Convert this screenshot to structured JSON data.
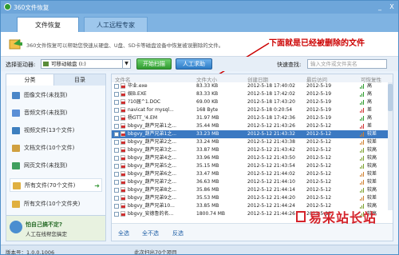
{
  "window": {
    "title": "360文件恢复",
    "minimize": "_",
    "close": "X"
  },
  "tabs": [
    {
      "label": "文件恢复"
    },
    {
      "label": "人工远程专家"
    }
  ],
  "info": {
    "description": "360文件恢复可以帮助您快速从硬盘、U盘、SD卡等磁盘设备中恢复被误删除的文件。",
    "annotation": "下面就是已经被删除的文件"
  },
  "toolbar": {
    "drive_label": "选择驱动器:",
    "drive_value": "可移动磁盘 (I:)",
    "scan_button": "开始扫描",
    "help_button": "人工求助",
    "quick_search_label": "快速查找:",
    "search_placeholder": "输入文件或文件夹名"
  },
  "sidebar": {
    "tabs": [
      {
        "label": "分类"
      },
      {
        "label": "目录"
      }
    ],
    "items": [
      {
        "label": "图像文件(未找到)",
        "color": "#4a86c8"
      },
      {
        "label": "音频文件(未找到)",
        "color": "#5b8fd6"
      },
      {
        "label": "视频文件(13个文件)",
        "color": "#3d7fbf"
      },
      {
        "label": "文档文件(10个文件)",
        "color": "#d0a040"
      },
      {
        "label": "网页文件(未找到)",
        "color": "#3f9f5f"
      },
      {
        "label": "所有文件(70个文件)",
        "color": "#e0b040"
      },
      {
        "label": "所有文件(10个文件夹)",
        "color": "#e0b040"
      }
    ],
    "help_title": "怕自己搞不定?",
    "help_sub": "人工在线帮您搞定"
  },
  "table": {
    "headers": [
      "文件名",
      "文件大小",
      "创建日期",
      "最后访问",
      "可恢复性"
    ],
    "rows": [
      {
        "name": "毕业.exe",
        "size": "83.33 KB",
        "created": "2012-5-18 17:40:02",
        "accessed": "2012-5-19",
        "recov": "高",
        "color": "#2a9a2a"
      },
      {
        "name": "娱B.EXE",
        "size": "83.33 KB",
        "created": "2012-5-18 17:42:02",
        "accessed": "2012-5-19",
        "recov": "高",
        "color": "#2a9a2a"
      },
      {
        "name": "?10届^1.DOC",
        "size": "69.00 KB",
        "created": "2012-5-18 17:43:20",
        "accessed": "2012-5-19",
        "recov": "高",
        "color": "#2a9a2a"
      },
      {
        "name": "navicat for mysql...",
        "size": "168 Byte",
        "created": "2012-5-18 0:20:54",
        "accessed": "2012-5-19",
        "recov": "差",
        "color": "#d03030"
      },
      {
        "name": "杨GTT_'4.EM",
        "size": "31.97 MB",
        "created": "2012-5-18 17:42:36",
        "accessed": "2012-5-19",
        "recov": "高",
        "color": "#2a9a2a"
      },
      {
        "name": "bbgvy_葫芦兄弟1之...",
        "size": "35.44 MB",
        "created": "2012-5-12 21:43:26",
        "accessed": "2012-5-12",
        "recov": "差",
        "color": "#d03030"
      },
      {
        "name": "bbgvy_葫芦兄弟1之...",
        "size": "33.23 MB",
        "created": "2012-5-12 21:43:32",
        "accessed": "2012-5-12",
        "recov": "较差",
        "color": "#d08030",
        "selected": true
      },
      {
        "name": "bbgvy_葫芦兄弟2之...",
        "size": "33.24 MB",
        "created": "2012-5-12 21:43:38",
        "accessed": "2012-5-12",
        "recov": "较差",
        "color": "#d08030"
      },
      {
        "name": "bbgvy_葫芦兄弟3之...",
        "size": "33.87 MB",
        "created": "2012-5-12 21:43:42",
        "accessed": "2012-5-12",
        "recov": "较高",
        "color": "#7aa02a"
      },
      {
        "name": "bbgvy_葫芦兄弟4之...",
        "size": "33.96 MB",
        "created": "2012-5-12 21:43:50",
        "accessed": "2012-5-12",
        "recov": "较高",
        "color": "#7aa02a"
      },
      {
        "name": "bbgvy_葫芦兄弟5之...",
        "size": "35.15 MB",
        "created": "2012-5-12 21:43:54",
        "accessed": "2012-5-12",
        "recov": "较高",
        "color": "#7aa02a"
      },
      {
        "name": "bbgvy_葫芦兄弟6之...",
        "size": "33.47 MB",
        "created": "2012-5-12 21:44:02",
        "accessed": "2012-5-12",
        "recov": "较差",
        "color": "#d08030"
      },
      {
        "name": "bbgvy_葫芦兄弟7之...",
        "size": "36.63 MB",
        "created": "2012-5-12 21:44:10",
        "accessed": "2012-5-12",
        "recov": "较差",
        "color": "#d08030"
      },
      {
        "name": "bbgvy_葫芦兄弟8之...",
        "size": "35.86 MB",
        "created": "2012-5-12 21:44:14",
        "accessed": "2012-5-12",
        "recov": "较高",
        "color": "#7aa02a"
      },
      {
        "name": "bbgvy_葫芦兄弟9之...",
        "size": "35.53 MB",
        "created": "2012-5-12 21:44:20",
        "accessed": "2012-5-12",
        "recov": "较差",
        "color": "#d08030"
      },
      {
        "name": "bbgvy_葫芦兄弟10...",
        "size": "33.85 MB",
        "created": "2012-5-12 21:44:24",
        "accessed": "2012-5-12",
        "recov": "较高",
        "color": "#7aa02a"
      },
      {
        "name": "bbgvy_安德鲁的名...",
        "size": "1800.74 MB",
        "created": "2012-5-12 21:44:26",
        "accessed": "2012-5-12",
        "recov": "较高",
        "color": "#7aa02a"
      }
    ],
    "footer": {
      "select_all": "全选",
      "deselect_all": "全不选",
      "invert": "反选"
    }
  },
  "status": {
    "version": "版本号：1.0.0.1006",
    "count": "此次扫出70个项目"
  },
  "watermark": {
    "text": "易采站长站"
  }
}
